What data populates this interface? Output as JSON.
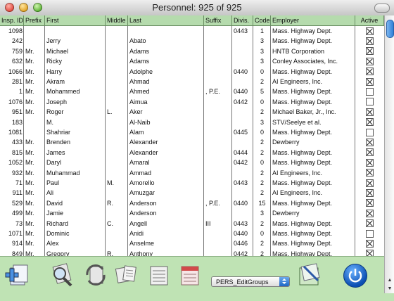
{
  "window": {
    "title": "Personnel: 925 of 925"
  },
  "columns": [
    {
      "key": "insp",
      "label": "Insp. ID"
    },
    {
      "key": "prefix",
      "label": "Prefix"
    },
    {
      "key": "first",
      "label": "First"
    },
    {
      "key": "middle",
      "label": "Middle"
    },
    {
      "key": "last",
      "label": "Last"
    },
    {
      "key": "suffix",
      "label": "Suffix"
    },
    {
      "key": "divis",
      "label": "Divis."
    },
    {
      "key": "code",
      "label": "Code"
    },
    {
      "key": "employer",
      "label": "Employer"
    },
    {
      "key": "active",
      "label": "Active"
    }
  ],
  "rows": [
    {
      "insp": "1098",
      "prefix": "",
      "first": "",
      "middle": "",
      "last": "",
      "suffix": "",
      "divis": "0443",
      "code": "1",
      "employer": "Mass. Highway Dept.",
      "active": true
    },
    {
      "insp": "242",
      "prefix": "",
      "first": "Jerry",
      "middle": "",
      "last": "Abato",
      "suffix": "",
      "divis": "",
      "code": "3",
      "employer": "Mass. Highway Dept.",
      "active": true
    },
    {
      "insp": "759",
      "prefix": "Mr.",
      "first": "Michael",
      "middle": "",
      "last": "Adams",
      "suffix": "",
      "divis": "",
      "code": "3",
      "employer": "HNTB Corporation",
      "active": true
    },
    {
      "insp": "632",
      "prefix": "Mr.",
      "first": "Ricky",
      "middle": "",
      "last": "Adams",
      "suffix": "",
      "divis": "",
      "code": "3",
      "employer": "Conley Associates, Inc.",
      "active": true
    },
    {
      "insp": "1066",
      "prefix": "Mr.",
      "first": "Harry",
      "middle": "",
      "last": "Adolphe",
      "suffix": "",
      "divis": "0440",
      "code": "0",
      "employer": "Mass. Highway Dept.",
      "active": true
    },
    {
      "insp": "281",
      "prefix": "Mr.",
      "first": "Akram",
      "middle": "",
      "last": "Ahmad",
      "suffix": "",
      "divis": "",
      "code": "2",
      "employer": "AI Engineers, Inc.",
      "active": true
    },
    {
      "insp": "1",
      "prefix": "Mr.",
      "first": "Mohammed",
      "middle": "",
      "last": "Ahmed",
      "suffix": ", P.E.",
      "divis": "0440",
      "code": "5",
      "employer": "Mass. Highway Dept.",
      "active": false
    },
    {
      "insp": "1076",
      "prefix": "Mr.",
      "first": "Joseph",
      "middle": "",
      "last": "Aimua",
      "suffix": "",
      "divis": "0442",
      "code": "0",
      "employer": "Mass. Highway Dept.",
      "active": false
    },
    {
      "insp": "951",
      "prefix": "Mr.",
      "first": "Roger",
      "middle": "L.",
      "last": "Aker",
      "suffix": "",
      "divis": "",
      "code": "2",
      "employer": "Michael Baker, Jr., Inc.",
      "active": true
    },
    {
      "insp": "183",
      "prefix": "",
      "first": "M.",
      "middle": "",
      "last": "Al-Naib",
      "suffix": "",
      "divis": "",
      "code": "3",
      "employer": "STV/Seelye et al.",
      "active": true
    },
    {
      "insp": "1081",
      "prefix": "",
      "first": "Shahriar",
      "middle": "",
      "last": "Alam",
      "suffix": "",
      "divis": "0445",
      "code": "0",
      "employer": "Mass. Highway Dept.",
      "active": false
    },
    {
      "insp": "433",
      "prefix": "Mr.",
      "first": "Brenden",
      "middle": "",
      "last": "Alexander",
      "suffix": "",
      "divis": "",
      "code": "2",
      "employer": "Dewberry",
      "active": true
    },
    {
      "insp": "815",
      "prefix": "Mr.",
      "first": "James",
      "middle": "",
      "last": "Alexander",
      "suffix": "",
      "divis": "0444",
      "code": "2",
      "employer": "Mass. Highway Dept.",
      "active": true
    },
    {
      "insp": "1052",
      "prefix": "Mr.",
      "first": "Daryl",
      "middle": "",
      "last": "Amaral",
      "suffix": "",
      "divis": "0442",
      "code": "0",
      "employer": "Mass. Highway Dept.",
      "active": true
    },
    {
      "insp": "932",
      "prefix": "Mr.",
      "first": "Muhammad",
      "middle": "",
      "last": "Ammad",
      "suffix": "",
      "divis": "",
      "code": "2",
      "employer": "AI Engineers, Inc.",
      "active": true
    },
    {
      "insp": "71",
      "prefix": "Mr.",
      "first": "Paul",
      "middle": "M.",
      "last": "Amorello",
      "suffix": "",
      "divis": "0443",
      "code": "2",
      "employer": "Mass. Highway Dept.",
      "active": true
    },
    {
      "insp": "911",
      "prefix": "Mr.",
      "first": "Ali",
      "middle": "",
      "last": "Amuzgar",
      "suffix": "",
      "divis": "",
      "code": "2",
      "employer": "AI Engineers, Inc.",
      "active": true
    },
    {
      "insp": "529",
      "prefix": "Mr.",
      "first": "David",
      "middle": "R.",
      "last": "Anderson",
      "suffix": ", P.E.",
      "divis": "0440",
      "code": "15",
      "employer": "Mass. Highway Dept.",
      "active": true
    },
    {
      "insp": "499",
      "prefix": "Mr.",
      "first": "Jamie",
      "middle": "",
      "last": "Anderson",
      "suffix": "",
      "divis": "",
      "code": "3",
      "employer": "Dewberry",
      "active": true
    },
    {
      "insp": "73",
      "prefix": "Mr.",
      "first": "Richard",
      "middle": "C.",
      "last": "Angell",
      "suffix": "III",
      "divis": "0443",
      "code": "2",
      "employer": "Mass. Highway Dept.",
      "active": true
    },
    {
      "insp": "1071",
      "prefix": "Mr.",
      "first": "Dominic",
      "middle": "",
      "last": "Anidi",
      "suffix": "",
      "divis": "0440",
      "code": "0",
      "employer": "Mass. Highway Dept.",
      "active": false
    },
    {
      "insp": "914",
      "prefix": "Mr.",
      "first": "Alex",
      "middle": "",
      "last": "Anselme",
      "suffix": "",
      "divis": "0446",
      "code": "2",
      "employer": "Mass. Highway Dept.",
      "active": true
    },
    {
      "insp": "849",
      "prefix": "Mr.",
      "first": "Gregory",
      "middle": "R.",
      "last": "Anthony",
      "suffix": "",
      "divis": "0442",
      "code": "2",
      "employer": "Mass. Highway Dept.",
      "active": true
    }
  ],
  "toolbar": {
    "layout_select": "PERS_EditGroups",
    "icons": [
      "add-record-icon",
      "find-icon",
      "refresh-icon",
      "print-icon",
      "list-view-icon",
      "report-icon",
      "export-icon",
      "power-icon"
    ]
  },
  "colors": {
    "background": "#bfe3b4",
    "grid": "#777777",
    "accent": "#2f7fd8"
  }
}
